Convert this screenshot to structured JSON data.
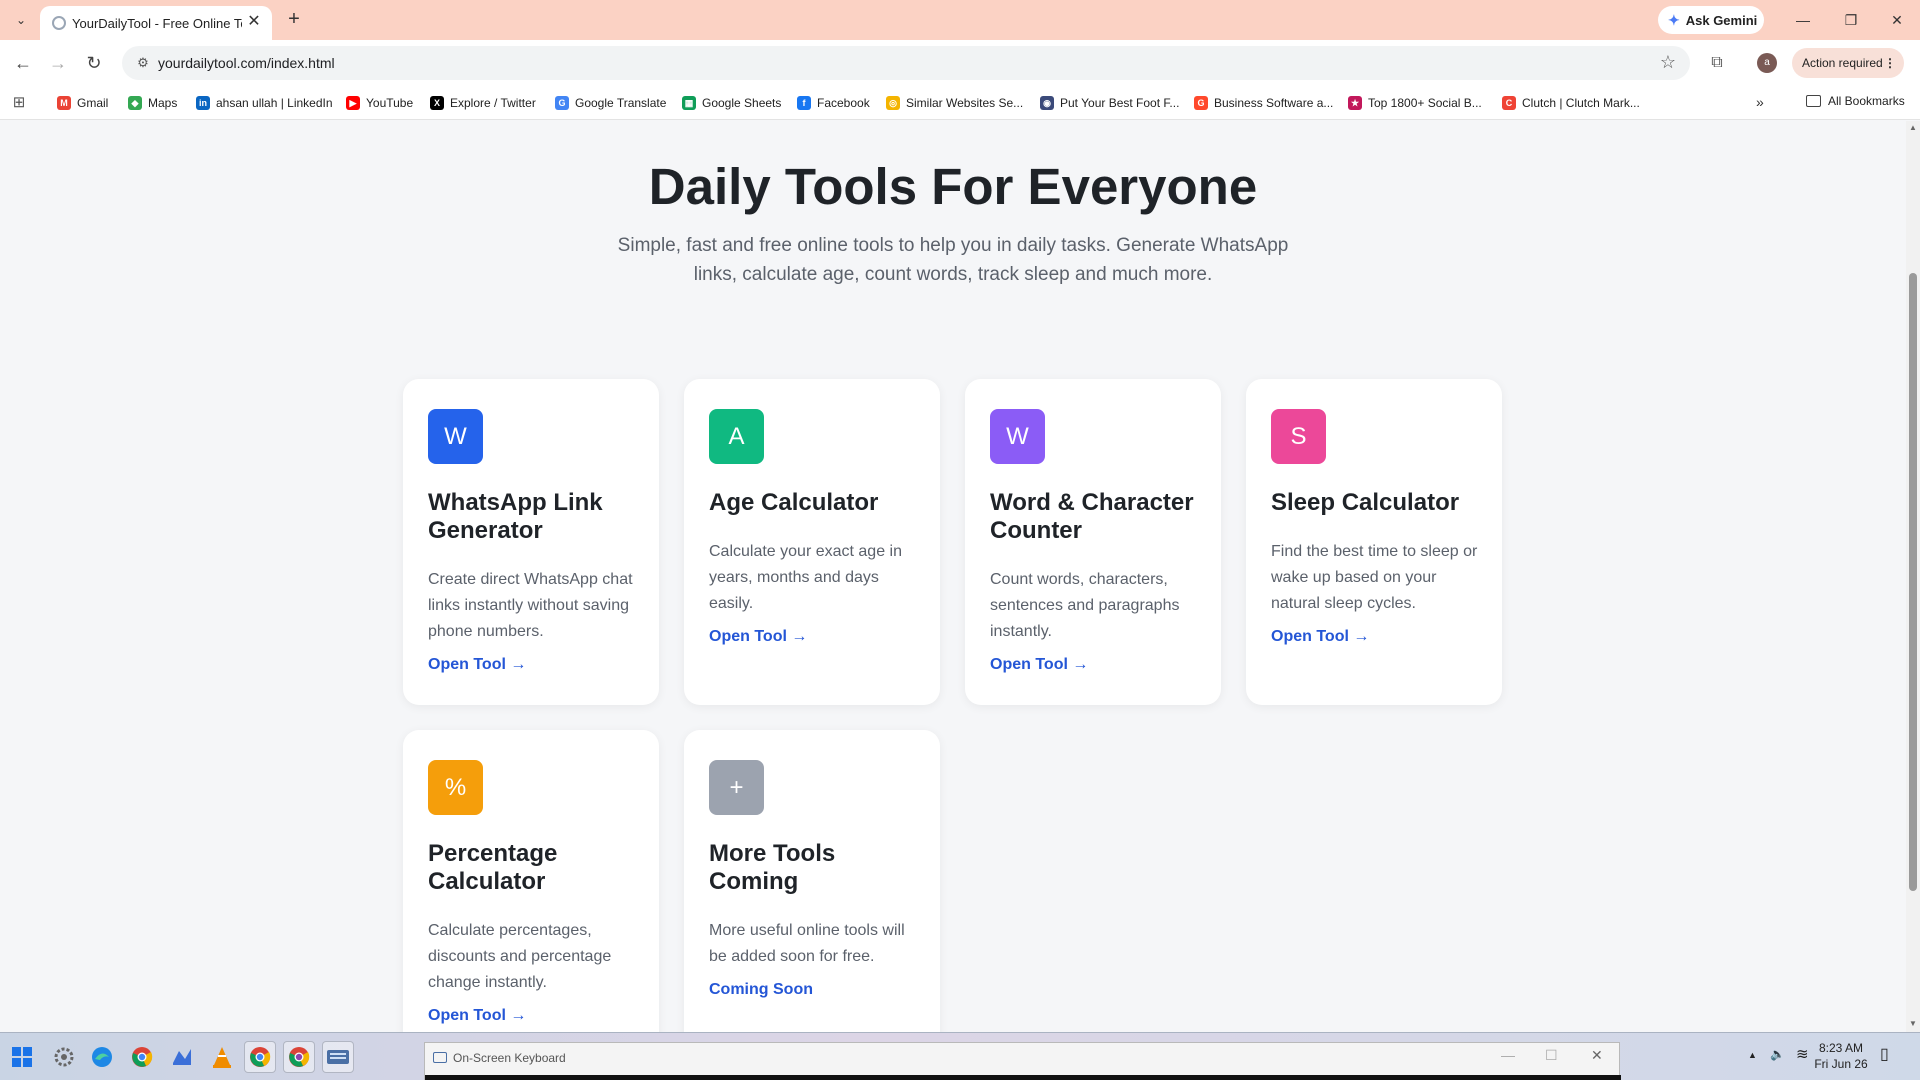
{
  "tab": {
    "title": "YourDailyTool - Free Online Tools",
    "close_glyph": "✕",
    "new_tab_glyph": "+"
  },
  "tabstrip": {
    "menu_glyph": "⌄",
    "gemini_label": "Ask Gemini",
    "minimize": "—",
    "restore": "❐",
    "close": "✕"
  },
  "toolbar": {
    "back": "←",
    "forward": "→",
    "reload": "↻",
    "url": "yourdailytool.com/index.html",
    "star": "☆",
    "extensions": "⧉",
    "profile_initial": "a",
    "action_required": "Action required",
    "menu_dots": "⋮"
  },
  "bookmarks": [
    {
      "label": "Gmail",
      "icon": "gmail-icon",
      "color": "#ea4335",
      "glyph": "M"
    },
    {
      "label": "Maps",
      "icon": "maps-icon",
      "color": "#34a853",
      "glyph": "◆"
    },
    {
      "label": "ahsan ullah | LinkedIn",
      "icon": "linkedin-icon",
      "color": "#0a66c2",
      "glyph": "in"
    },
    {
      "label": "YouTube",
      "icon": "youtube-icon",
      "color": "#ff0000",
      "glyph": "▶"
    },
    {
      "label": "Explore / Twitter",
      "icon": "x-icon",
      "color": "#000000",
      "glyph": "X"
    },
    {
      "label": "Google Translate",
      "icon": "translate-icon",
      "color": "#4285f4",
      "glyph": "G"
    },
    {
      "label": "Google Sheets",
      "icon": "sheets-icon",
      "color": "#0f9d58",
      "glyph": "▦"
    },
    {
      "label": "Facebook",
      "icon": "facebook-icon",
      "color": "#1877f2",
      "glyph": "f"
    },
    {
      "label": "Similar Websites Se...",
      "icon": "similar-sites-icon",
      "color": "#f4b400",
      "glyph": "◎"
    },
    {
      "label": "Put Your Best Foot F...",
      "icon": "globe-icon",
      "color": "#3b4a7a",
      "glyph": "◉"
    },
    {
      "label": "Business Software a...",
      "icon": "g2-icon",
      "color": "#ff492c",
      "glyph": "G"
    },
    {
      "label": "Top 1800+ Social B...",
      "icon": "social-bookmark-icon",
      "color": "#c2185b",
      "glyph": "★"
    },
    {
      "label": "Clutch | Clutch Mark...",
      "icon": "clutch-icon",
      "color": "#ef4335",
      "glyph": "C"
    }
  ],
  "bookmarks_more": "»",
  "all_bookmarks": "All Bookmarks",
  "hero": {
    "title": "Daily Tools For Everyone",
    "subtitle": "Simple, fast and free online tools to help you in daily tasks. Generate WhatsApp links, calculate age, count words, track sleep and much more."
  },
  "cards": [
    {
      "badge": "W",
      "color": "#2563eb",
      "title": "WhatsApp Link Generator",
      "desc": "Create direct WhatsApp chat links instantly without saving phone numbers.",
      "link": "Open Tool →"
    },
    {
      "badge": "A",
      "color": "#10b981",
      "title": "Age Calculator",
      "desc": "Calculate your exact age in years, months and days easily.",
      "link": "Open Tool →"
    },
    {
      "badge": "W",
      "color": "#8b5cf6",
      "title": "Word & Character Counter",
      "desc": "Count words, characters, sentences and paragraphs instantly.",
      "link": "Open Tool →"
    },
    {
      "badge": "S",
      "color": "#ec4899",
      "title": "Sleep Calculator",
      "desc": "Find the best time to sleep or wake up based on your natural sleep cycles.",
      "link": "Open Tool →"
    },
    {
      "badge": "%",
      "color": "#f59e0b",
      "title": "Percentage Calculator",
      "desc": "Calculate percentages, discounts and percentage change instantly.",
      "link": "Open Tool →"
    },
    {
      "badge": "+",
      "color": "#9ca3af",
      "title": "More Tools Coming",
      "desc": "More useful online tools will be added soon for free.",
      "link": "Coming Soon"
    }
  ],
  "scrollbar": {
    "up": "▲",
    "down": "▼"
  },
  "taskbar": {
    "osk_title": "On-Screen Keyboard",
    "osk_min": "—",
    "osk_max": "☐",
    "osk_close": "✕",
    "tray_arrow": "▲",
    "volume": "🔈",
    "wifi": "≋",
    "time": "8:23 AM",
    "date": "Fri Jun 26"
  }
}
